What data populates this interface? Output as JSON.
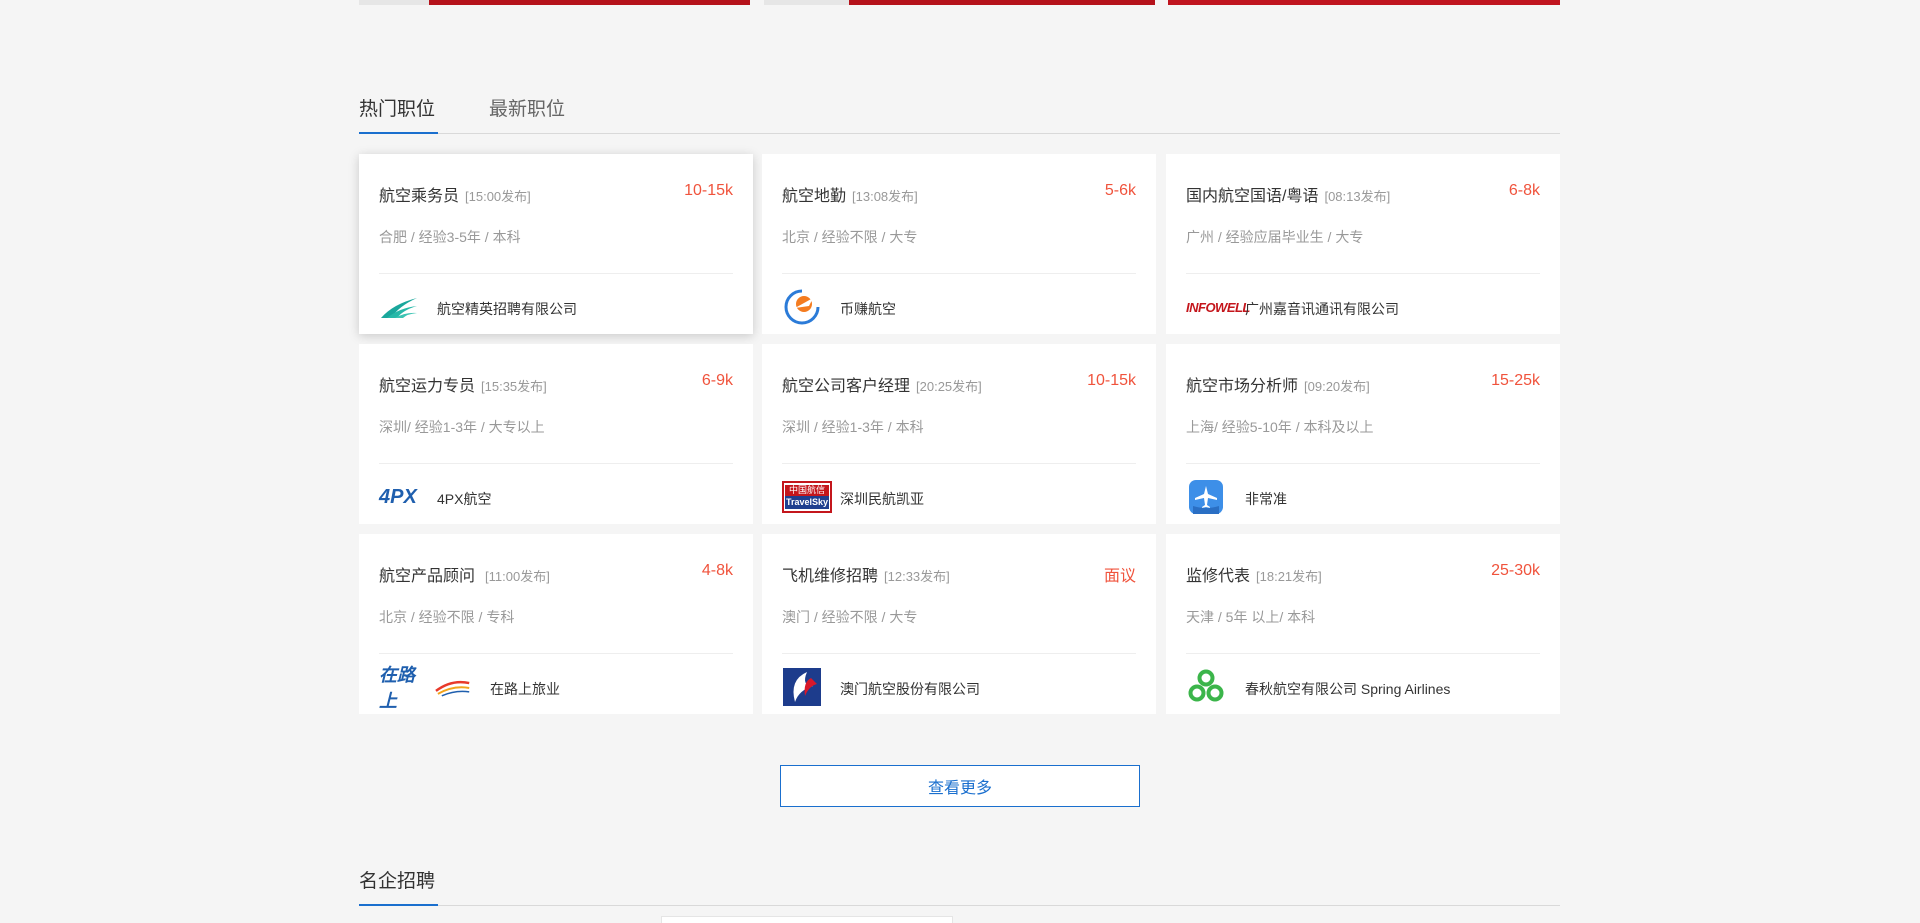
{
  "tabs": [
    {
      "label": "热门职位",
      "active": true
    },
    {
      "label": "最新职位",
      "active": false
    }
  ],
  "jobs": [
    {
      "title": "航空乘务员",
      "time": "[15:00发布]",
      "salary": "10-15k",
      "meta": "合肥 / 经验3-5年 / 本科",
      "company": "航空精英招聘有限公司",
      "logo": "wing-logo"
    },
    {
      "title": "航空地勤",
      "time": "[13:08发布]",
      "salary": "5-6k",
      "meta": "北京 / 经验不限 / 大专",
      "company": "币赚航空",
      "logo": "circle-plane-logo"
    },
    {
      "title": "国内航空国语/粤语",
      "time": "[08:13发布]",
      "salary": "6-8k",
      "meta": "广州 / 经验应届毕业生 / 大专",
      "company": "广州嘉音讯通讯有限公司",
      "logo": "infowell-logo",
      "logo_text": "INFOWELL"
    },
    {
      "title": "航空运力专员",
      "time": "[15:35发布]",
      "salary": "6-9k",
      "meta": "深圳/ 经验1-3年 / 大专以上",
      "company": "4PX航空",
      "logo": "4px-logo",
      "logo_text": "4PX"
    },
    {
      "title": "航空公司客户经理",
      "time": "[20:25发布]",
      "salary": "10-15k",
      "meta": "深圳 / 经验1-3年 / 本科",
      "company": "深圳民航凯亚",
      "logo": "travelsky-logo",
      "logo_text_top": "中国航信",
      "logo_text_bottom": "TravelSky"
    },
    {
      "title": "航空市场分析师",
      "time": "[09:20发布]",
      "salary": "15-25k",
      "meta": "上海/ 经验5-10年 / 本科及以上",
      "company": "非常准",
      "logo": "plane-app-logo"
    },
    {
      "title": "航空产品顾问",
      "time": "[11:00发布]",
      "salary": "4-8k",
      "meta": "北京 / 经验不限 / 专科",
      "company": "在路上旅业",
      "logo": "zailushang-logo",
      "logo_text": "在路上"
    },
    {
      "title": "飞机维修招聘",
      "time": "[12:33发布]",
      "salary": "面议",
      "meta": "澳门 / 经验不限 / 大专",
      "company": "澳门航空股份有限公司",
      "logo": "air-macau-logo"
    },
    {
      "title": "监修代表",
      "time": "[18:21发布]",
      "salary": "25-30k",
      "meta": "天津 / 5年 以上/ 本科",
      "company": "春秋航空有限公司 Spring Airlines",
      "logo": "spring-airlines-logo"
    }
  ],
  "more_button": "查看更多",
  "section2": {
    "heading": "名企招聘"
  },
  "colors": {
    "accent": "#1a6fce",
    "salary": "#f0533c",
    "banner_red": "#b5121b"
  }
}
